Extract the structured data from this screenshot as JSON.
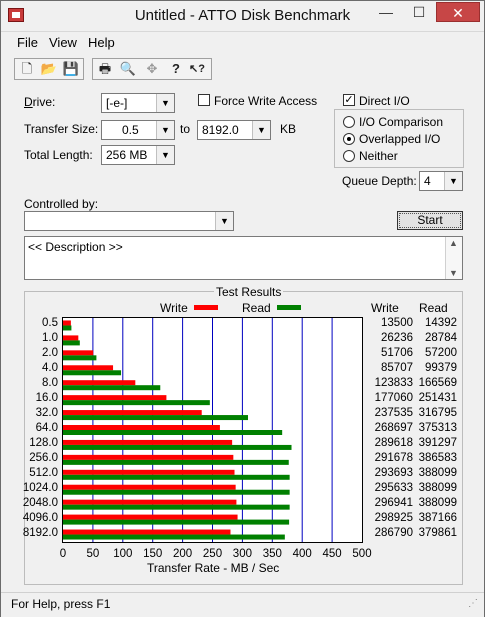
{
  "window": {
    "title": "Untitled - ATTO Disk Benchmark",
    "controls": {
      "minimize": "—",
      "maximize": "☐",
      "close": "✕"
    }
  },
  "menu": {
    "file": "File",
    "view": "View",
    "help": "Help"
  },
  "toolbar": {
    "icons": [
      "new-icon",
      "open-icon",
      "save-icon",
      "print-icon",
      "print-preview-icon",
      "move-icon",
      "help-icon",
      "context-help-icon"
    ],
    "glyphs": {
      "new": "🗋",
      "open": "📂",
      "save": "💾",
      "print": "🖶",
      "preview": "🔍",
      "move": "✥",
      "help": "?",
      "context_help": "↖?"
    }
  },
  "settings": {
    "drive_label_pre": "D",
    "drive_label_post": "rive:",
    "drive_value": "[-e-]",
    "force_write_access": "Force Write Access",
    "transfer_size_label": "Transfer Size:",
    "transfer_size_from": "0.5",
    "to_label": "to",
    "transfer_size_to": "8192.0",
    "kb_label": "KB",
    "total_length_label": "Total Length:",
    "total_length_value": "256 MB",
    "direct_io": "Direct I/O",
    "direct_io_checked": true,
    "io_comparison": "I/O Comparison",
    "overlapped_io": "Overlapped I/O",
    "neither": "Neither",
    "selected_io": "Overlapped I/O",
    "queue_depth_label": "Queue Depth:",
    "queue_depth_value": "4",
    "controlled_by_label": "Controlled by:",
    "controlled_by_value": "",
    "start_button": "Start",
    "description": "<< Description >>"
  },
  "chart_data": {
    "type": "bar",
    "title": "Test Results",
    "xlabel": "Transfer Rate - MB / Sec",
    "xlim": [
      0,
      500
    ],
    "xticks": [
      0,
      50,
      100,
      150,
      200,
      250,
      300,
      350,
      400,
      450,
      500
    ],
    "categories": [
      "0.5",
      "1.0",
      "2.0",
      "4.0",
      "8.0",
      "16.0",
      "32.0",
      "64.0",
      "128.0",
      "256.0",
      "512.0",
      "1024.0",
      "2048.0",
      "4096.0",
      "8192.0"
    ],
    "legend": [
      {
        "name": "Write",
        "color": "#ff0000"
      },
      {
        "name": "Read",
        "color": "#008000"
      }
    ],
    "column_headers": {
      "write": "Write",
      "read": "Read"
    },
    "series": [
      {
        "name": "Write",
        "color": "#ff0000",
        "values": [
          13500,
          26236,
          51706,
          85707,
          123833,
          177060,
          237535,
          268697,
          289618,
          291678,
          293693,
          295633,
          296941,
          298925,
          286790
        ]
      },
      {
        "name": "Read",
        "color": "#008000",
        "values": [
          14392,
          28784,
          57200,
          99379,
          166569,
          251431,
          316795,
          375313,
          391297,
          386583,
          388099,
          388099,
          388099,
          387166,
          379861
        ]
      }
    ],
    "grid": true
  },
  "status": {
    "text": "For Help, press F1"
  }
}
